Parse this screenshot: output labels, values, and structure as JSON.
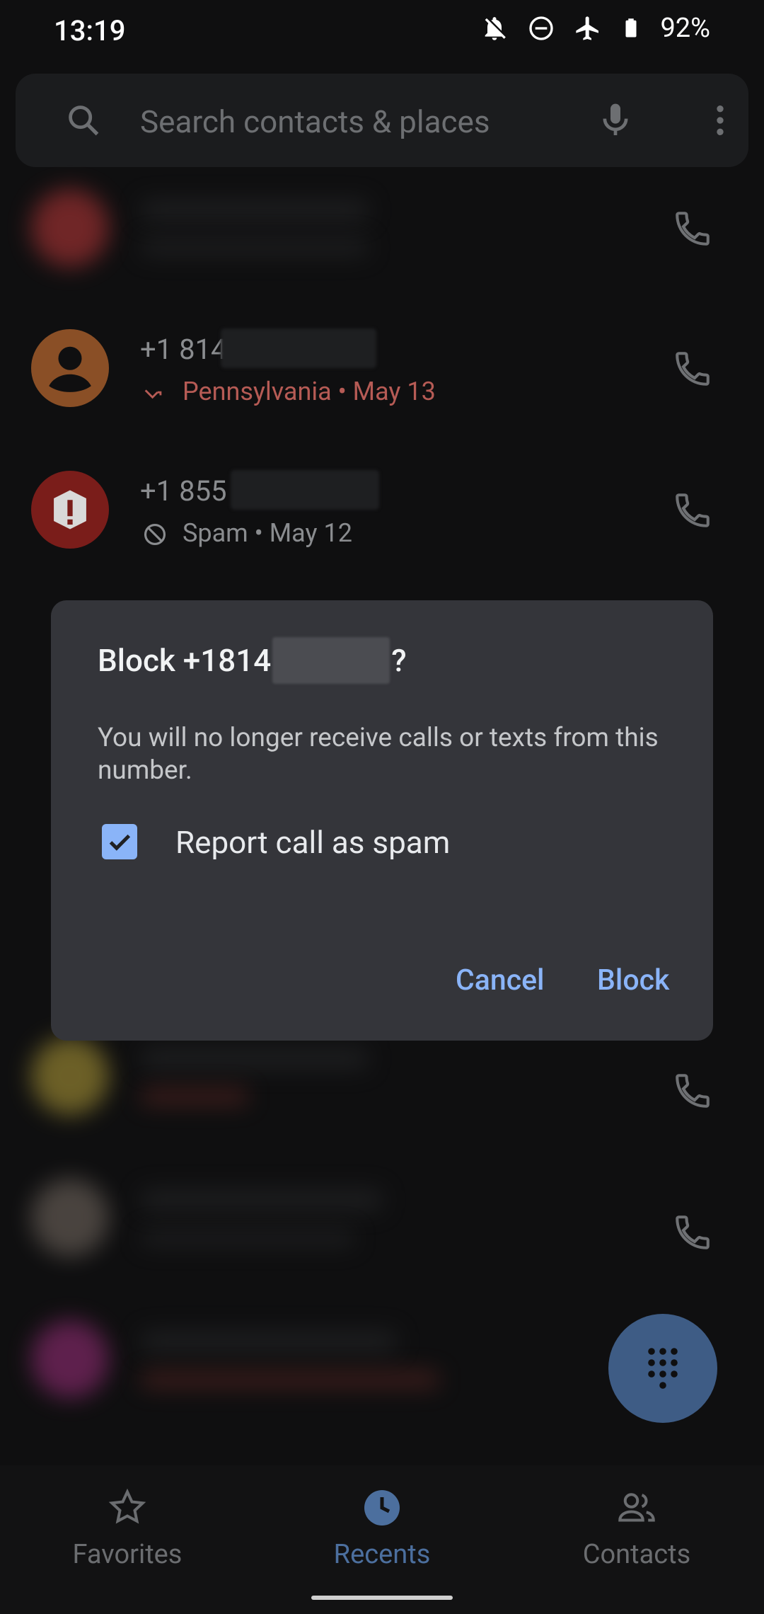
{
  "status_bar": {
    "time": "13:19",
    "battery": "92%"
  },
  "search": {
    "placeholder": "Search contacts & places"
  },
  "call_log": [
    {
      "number_prefix": "+1 814",
      "detail": "Pennsylvania • May 13",
      "detail_color": "#b65b55"
    },
    {
      "number_prefix": "+1 855",
      "detail": "Spam • May 12",
      "detail_color": "#8a8c8f"
    }
  ],
  "dialog": {
    "title_prefix": "Block +1814",
    "title_suffix": "?",
    "message": "You will no longer receive calls or texts from this number.",
    "checkbox_label": "Report call as spam",
    "checkbox_checked": true,
    "cancel_label": "Cancel",
    "block_label": "Block"
  },
  "bottom_nav": [
    {
      "label": "Favorites",
      "active": false
    },
    {
      "label": "Recents",
      "active": true
    },
    {
      "label": "Contacts",
      "active": false
    }
  ],
  "colors": {
    "accent": "#8ab4f8",
    "dialog_bg": "#34353a",
    "fab": "#3e5c85"
  }
}
